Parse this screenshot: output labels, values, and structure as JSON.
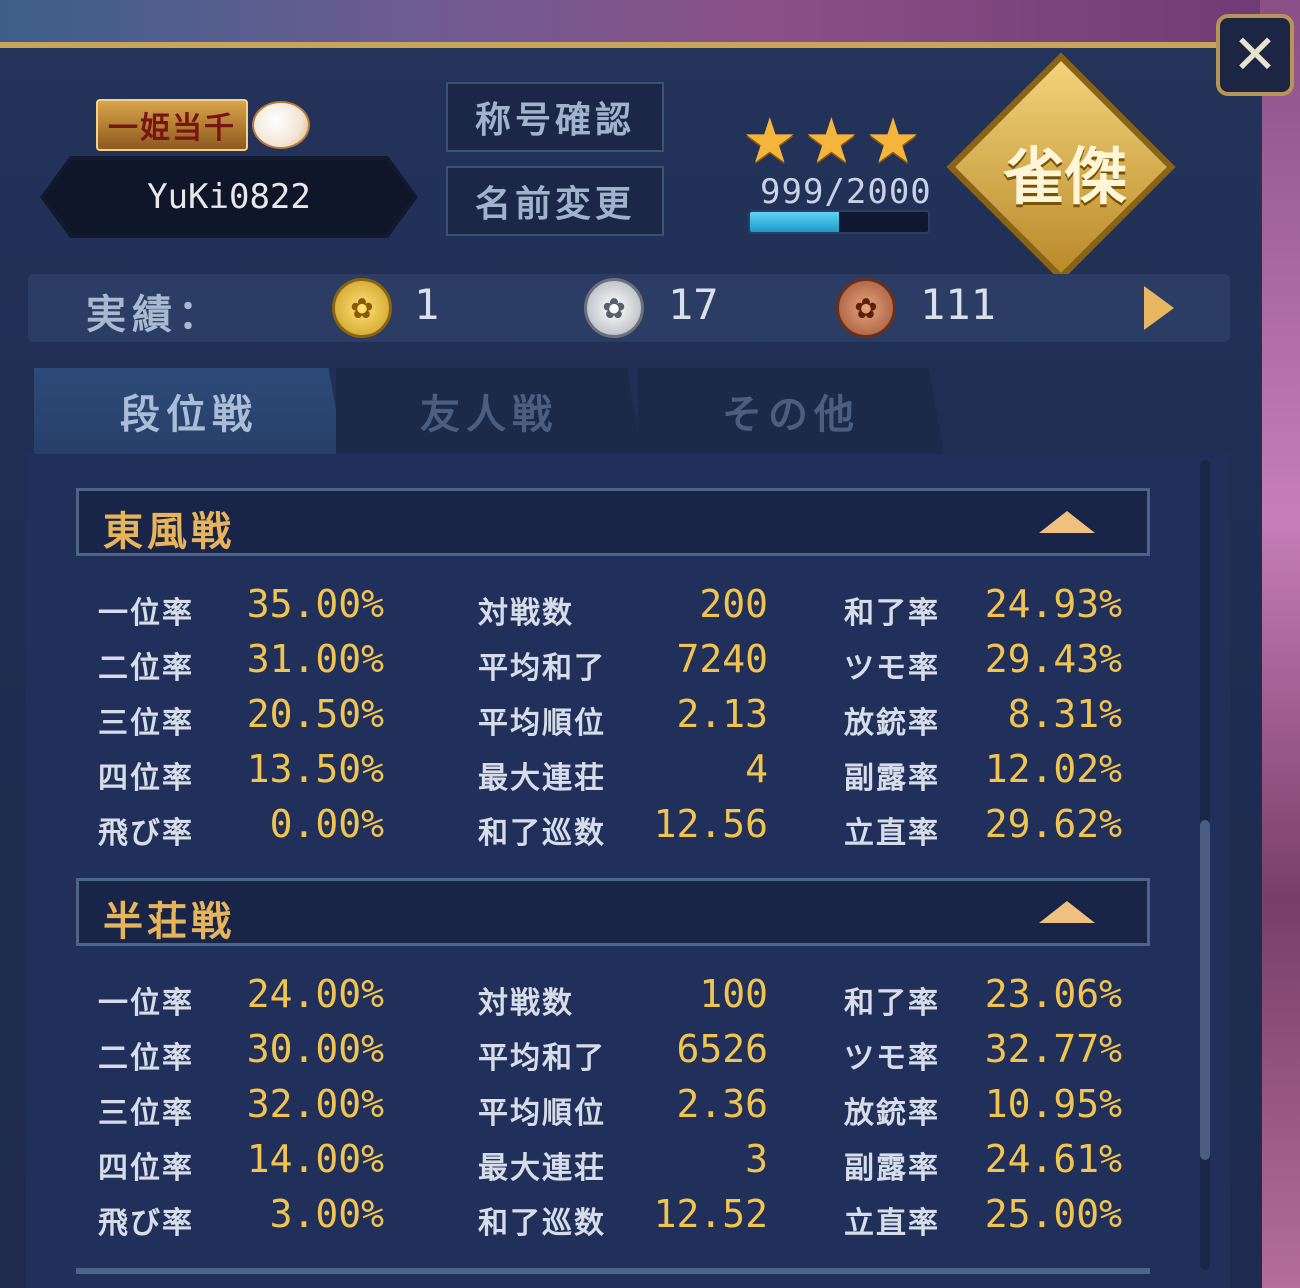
{
  "colors": {
    "panel_bg": "#21305a",
    "accent_gold": "#f1c44f",
    "section_title": "#e7b45a",
    "label_text": "#d6dde8",
    "exp_bar": "#1b9bc9"
  },
  "close_button": {
    "icon": "close-icon",
    "glyph": "✕"
  },
  "profile": {
    "title_badge": "一姫当千",
    "player_name": "YuKi0822",
    "title_check_label": "称号確認",
    "name_change_label": "名前変更",
    "stars_glyph": "★",
    "star_count": 3,
    "exp_text": "999/2000",
    "exp_fraction": 0.4995,
    "rank_emblem_text": "雀傑"
  },
  "achievements": {
    "label": "実績：",
    "gold": {
      "icon": "gold-medal-icon",
      "count": "1"
    },
    "silver": {
      "icon": "silver-medal-icon",
      "count": "17"
    },
    "bronze": {
      "icon": "bronze-medal-icon",
      "count": "111"
    },
    "next_icon": "arrow-right-icon"
  },
  "tabs": [
    {
      "label": "段位戦",
      "active": true
    },
    {
      "label": "友人戦",
      "active": false
    },
    {
      "label": "その他",
      "active": false
    }
  ],
  "sections": [
    {
      "title": "東風戦",
      "col1": [
        {
          "label": "一位率",
          "value": "35.00%"
        },
        {
          "label": "二位率",
          "value": "31.00%"
        },
        {
          "label": "三位率",
          "value": "20.50%"
        },
        {
          "label": "四位率",
          "value": "13.50%"
        },
        {
          "label": "飛び率",
          "value": "0.00%"
        }
      ],
      "col2": [
        {
          "label": "対戦数",
          "value": "200"
        },
        {
          "label": "平均和了",
          "value": "7240"
        },
        {
          "label": "平均順位",
          "value": "2.13"
        },
        {
          "label": "最大連荘",
          "value": "4"
        },
        {
          "label": "和了巡数",
          "value": "12.56"
        }
      ],
      "col3": [
        {
          "label": "和了率",
          "value": "24.93%"
        },
        {
          "label": "ツモ率",
          "value": "29.43%"
        },
        {
          "label": "放銃率",
          "value": "8.31%"
        },
        {
          "label": "副露率",
          "value": "12.02%"
        },
        {
          "label": "立直率",
          "value": "29.62%"
        }
      ]
    },
    {
      "title": "半荘戦",
      "col1": [
        {
          "label": "一位率",
          "value": "24.00%"
        },
        {
          "label": "二位率",
          "value": "30.00%"
        },
        {
          "label": "三位率",
          "value": "32.00%"
        },
        {
          "label": "四位率",
          "value": "14.00%"
        },
        {
          "label": "飛び率",
          "value": "3.00%"
        }
      ],
      "col2": [
        {
          "label": "対戦数",
          "value": "100"
        },
        {
          "label": "平均和了",
          "value": "6526"
        },
        {
          "label": "平均順位",
          "value": "2.36"
        },
        {
          "label": "最大連荘",
          "value": "3"
        },
        {
          "label": "和了巡数",
          "value": "12.52"
        }
      ],
      "col3": [
        {
          "label": "和了率",
          "value": "23.06%"
        },
        {
          "label": "ツモ率",
          "value": "32.77%"
        },
        {
          "label": "放銃率",
          "value": "10.95%"
        },
        {
          "label": "副露率",
          "value": "24.61%"
        },
        {
          "label": "立直率",
          "value": "25.00%"
        }
      ]
    }
  ]
}
